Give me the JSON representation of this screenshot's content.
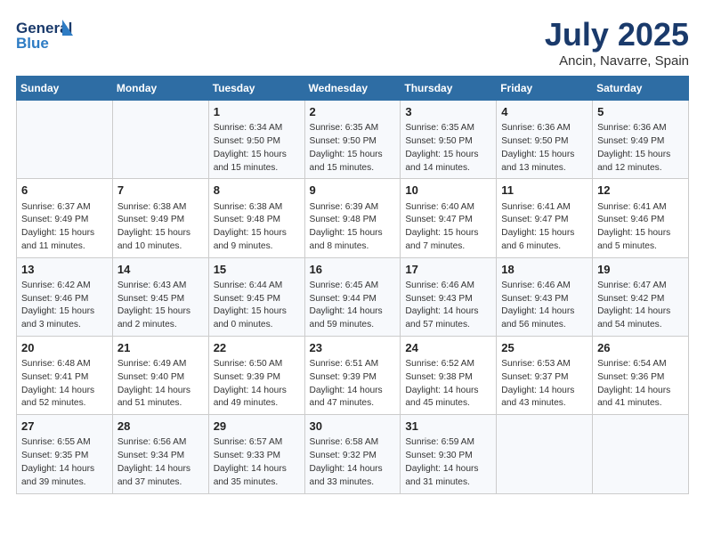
{
  "header": {
    "logo_line1": "General",
    "logo_line2": "Blue",
    "main_title": "July 2025",
    "sub_title": "Ancin, Navarre, Spain"
  },
  "days_of_week": [
    "Sunday",
    "Monday",
    "Tuesday",
    "Wednesday",
    "Thursday",
    "Friday",
    "Saturday"
  ],
  "weeks": [
    [
      {
        "day": "",
        "content": ""
      },
      {
        "day": "",
        "content": ""
      },
      {
        "day": "1",
        "content": "Sunrise: 6:34 AM\nSunset: 9:50 PM\nDaylight: 15 hours and 15 minutes."
      },
      {
        "day": "2",
        "content": "Sunrise: 6:35 AM\nSunset: 9:50 PM\nDaylight: 15 hours and 15 minutes."
      },
      {
        "day": "3",
        "content": "Sunrise: 6:35 AM\nSunset: 9:50 PM\nDaylight: 15 hours and 14 minutes."
      },
      {
        "day": "4",
        "content": "Sunrise: 6:36 AM\nSunset: 9:50 PM\nDaylight: 15 hours and 13 minutes."
      },
      {
        "day": "5",
        "content": "Sunrise: 6:36 AM\nSunset: 9:49 PM\nDaylight: 15 hours and 12 minutes."
      }
    ],
    [
      {
        "day": "6",
        "content": "Sunrise: 6:37 AM\nSunset: 9:49 PM\nDaylight: 15 hours and 11 minutes."
      },
      {
        "day": "7",
        "content": "Sunrise: 6:38 AM\nSunset: 9:49 PM\nDaylight: 15 hours and 10 minutes."
      },
      {
        "day": "8",
        "content": "Sunrise: 6:38 AM\nSunset: 9:48 PM\nDaylight: 15 hours and 9 minutes."
      },
      {
        "day": "9",
        "content": "Sunrise: 6:39 AM\nSunset: 9:48 PM\nDaylight: 15 hours and 8 minutes."
      },
      {
        "day": "10",
        "content": "Sunrise: 6:40 AM\nSunset: 9:47 PM\nDaylight: 15 hours and 7 minutes."
      },
      {
        "day": "11",
        "content": "Sunrise: 6:41 AM\nSunset: 9:47 PM\nDaylight: 15 hours and 6 minutes."
      },
      {
        "day": "12",
        "content": "Sunrise: 6:41 AM\nSunset: 9:46 PM\nDaylight: 15 hours and 5 minutes."
      }
    ],
    [
      {
        "day": "13",
        "content": "Sunrise: 6:42 AM\nSunset: 9:46 PM\nDaylight: 15 hours and 3 minutes."
      },
      {
        "day": "14",
        "content": "Sunrise: 6:43 AM\nSunset: 9:45 PM\nDaylight: 15 hours and 2 minutes."
      },
      {
        "day": "15",
        "content": "Sunrise: 6:44 AM\nSunset: 9:45 PM\nDaylight: 15 hours and 0 minutes."
      },
      {
        "day": "16",
        "content": "Sunrise: 6:45 AM\nSunset: 9:44 PM\nDaylight: 14 hours and 59 minutes."
      },
      {
        "day": "17",
        "content": "Sunrise: 6:46 AM\nSunset: 9:43 PM\nDaylight: 14 hours and 57 minutes."
      },
      {
        "day": "18",
        "content": "Sunrise: 6:46 AM\nSunset: 9:43 PM\nDaylight: 14 hours and 56 minutes."
      },
      {
        "day": "19",
        "content": "Sunrise: 6:47 AM\nSunset: 9:42 PM\nDaylight: 14 hours and 54 minutes."
      }
    ],
    [
      {
        "day": "20",
        "content": "Sunrise: 6:48 AM\nSunset: 9:41 PM\nDaylight: 14 hours and 52 minutes."
      },
      {
        "day": "21",
        "content": "Sunrise: 6:49 AM\nSunset: 9:40 PM\nDaylight: 14 hours and 51 minutes."
      },
      {
        "day": "22",
        "content": "Sunrise: 6:50 AM\nSunset: 9:39 PM\nDaylight: 14 hours and 49 minutes."
      },
      {
        "day": "23",
        "content": "Sunrise: 6:51 AM\nSunset: 9:39 PM\nDaylight: 14 hours and 47 minutes."
      },
      {
        "day": "24",
        "content": "Sunrise: 6:52 AM\nSunset: 9:38 PM\nDaylight: 14 hours and 45 minutes."
      },
      {
        "day": "25",
        "content": "Sunrise: 6:53 AM\nSunset: 9:37 PM\nDaylight: 14 hours and 43 minutes."
      },
      {
        "day": "26",
        "content": "Sunrise: 6:54 AM\nSunset: 9:36 PM\nDaylight: 14 hours and 41 minutes."
      }
    ],
    [
      {
        "day": "27",
        "content": "Sunrise: 6:55 AM\nSunset: 9:35 PM\nDaylight: 14 hours and 39 minutes."
      },
      {
        "day": "28",
        "content": "Sunrise: 6:56 AM\nSunset: 9:34 PM\nDaylight: 14 hours and 37 minutes."
      },
      {
        "day": "29",
        "content": "Sunrise: 6:57 AM\nSunset: 9:33 PM\nDaylight: 14 hours and 35 minutes."
      },
      {
        "day": "30",
        "content": "Sunrise: 6:58 AM\nSunset: 9:32 PM\nDaylight: 14 hours and 33 minutes."
      },
      {
        "day": "31",
        "content": "Sunrise: 6:59 AM\nSunset: 9:30 PM\nDaylight: 14 hours and 31 minutes."
      },
      {
        "day": "",
        "content": ""
      },
      {
        "day": "",
        "content": ""
      }
    ]
  ]
}
